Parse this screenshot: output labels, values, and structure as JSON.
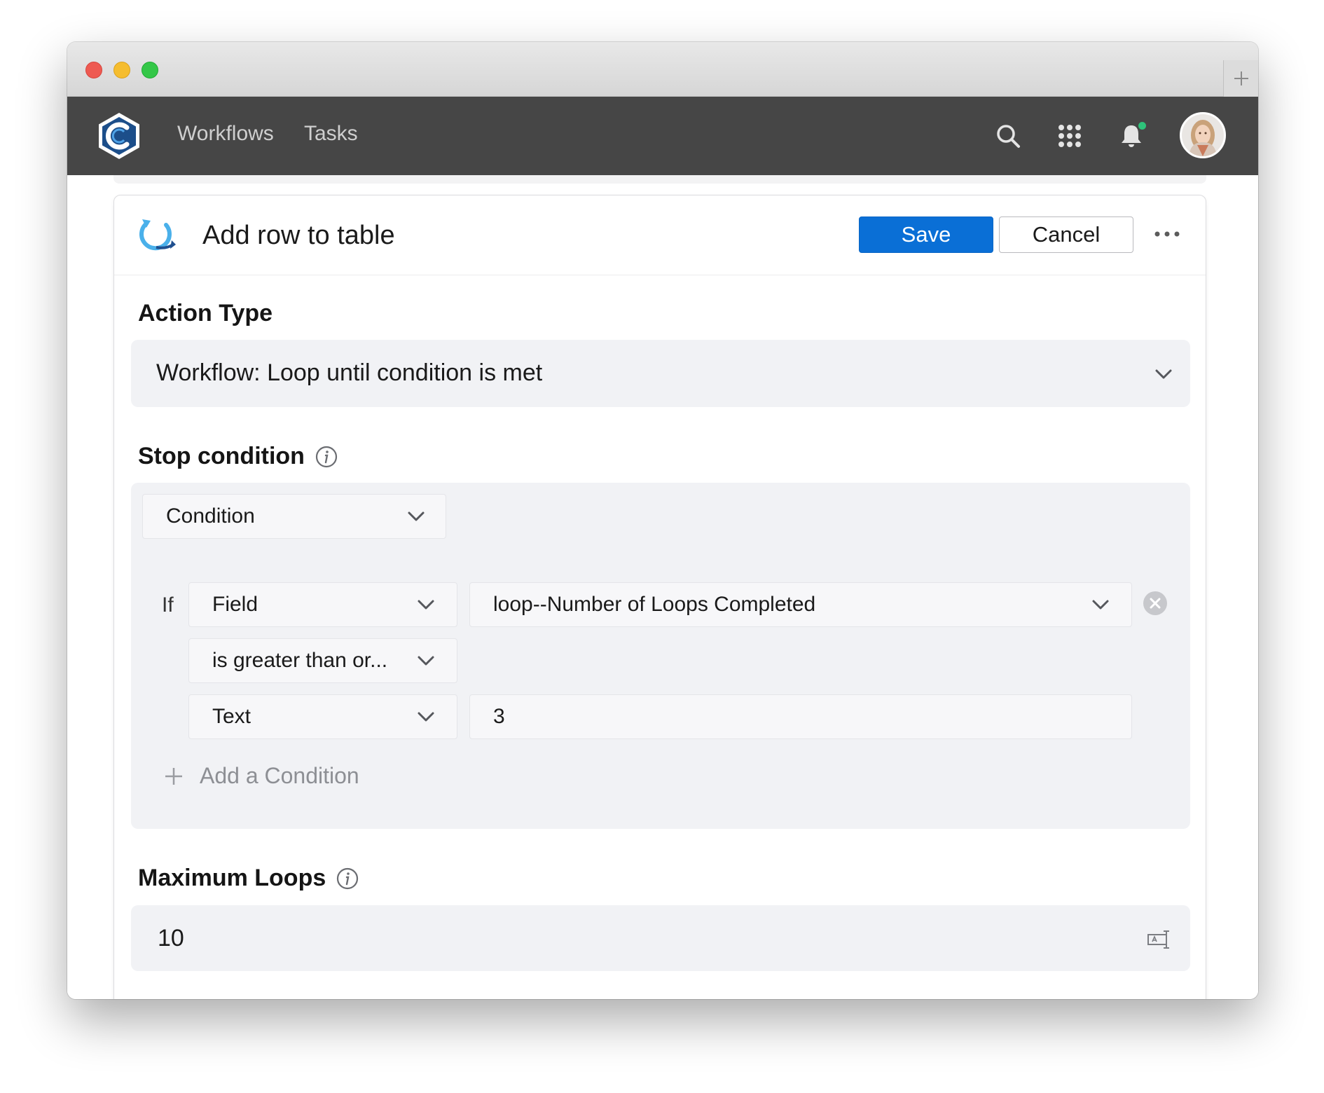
{
  "nav": {
    "links": [
      "Workflows",
      "Tasks"
    ]
  },
  "card": {
    "title": "Add row to table",
    "save_label": "Save",
    "cancel_label": "Cancel"
  },
  "action_type": {
    "label": "Action Type",
    "value": "Workflow: Loop until condition is met"
  },
  "stop_condition": {
    "label": "Stop condition",
    "group_type": "Condition",
    "if_label": "If",
    "left_operand_type": "Field",
    "left_operand_value": "loop--Number of Loops Completed",
    "operator": "is greater than or...",
    "right_operand_type": "Text",
    "right_operand_value": "3",
    "add_label": "Add a Condition"
  },
  "maximum_loops": {
    "label": "Maximum Loops",
    "value": "10"
  },
  "colors": {
    "primary": "#0a6fd6",
    "navbar": "#464646",
    "notification_dot": "#2ec27a",
    "panel": "#f1f2f5"
  },
  "icons": [
    "search-icon",
    "apps-grid-icon",
    "bell-icon",
    "info-icon",
    "chevron-down-icon",
    "close-circle-icon",
    "plus-icon",
    "text-field-icon",
    "more-icon",
    "loop-action-icon"
  ]
}
